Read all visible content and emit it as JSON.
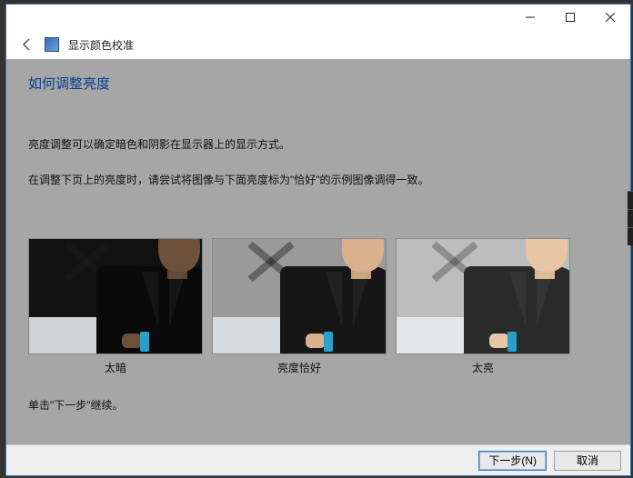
{
  "titlebar": {
    "minimize_icon": "minimize-icon",
    "maximize_icon": "maximize-icon",
    "close_icon": "close-icon"
  },
  "header": {
    "back_icon": "back-icon",
    "app_title": "显示颜色校准"
  },
  "page": {
    "heading": "如何调整亮度",
    "para1": "亮度调整可以确定暗色和阴影在显示器上的显示方式。",
    "para2": "在调整下页上的亮度时，请尝试将图像与下面亮度标为\"恰好\"的示例图像调得一致。",
    "continue_prompt": "单击\"下一步\"继续。"
  },
  "examples": [
    {
      "caption": "太暗"
    },
    {
      "caption": "亮度恰好"
    },
    {
      "caption": "太亮"
    }
  ],
  "footer": {
    "next_label": "下一步(N)",
    "cancel_label": "取消"
  }
}
